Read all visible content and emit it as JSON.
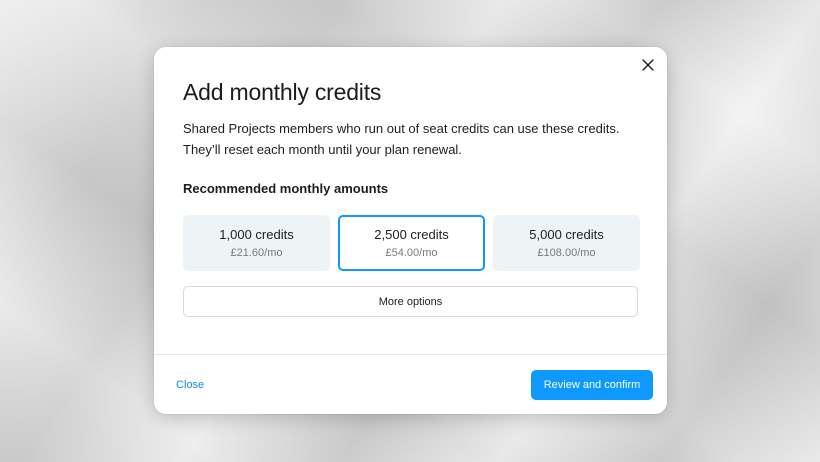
{
  "dialog": {
    "title": "Add monthly credits",
    "description_line1": "Shared Projects members who run out of seat credits can use these credits.",
    "description_line2": "They’ll reset each month until your plan renewal.",
    "section_label": "Recommended monthly amounts",
    "close_icon": "close-icon",
    "options": [
      {
        "credits": "1,000 credits",
        "price": "£21.60/mo",
        "selected": false
      },
      {
        "credits": "2,500 credits",
        "price": "£54.00/mo",
        "selected": true
      },
      {
        "credits": "5,000 credits",
        "price": "£108.00/mo",
        "selected": false
      }
    ],
    "more_options_label": "More options",
    "close_label": "Close",
    "confirm_label": "Review and confirm"
  },
  "colors": {
    "accent": "#0d99ff",
    "option_bg": "#eef3f6",
    "link": "#0d8ce0"
  }
}
